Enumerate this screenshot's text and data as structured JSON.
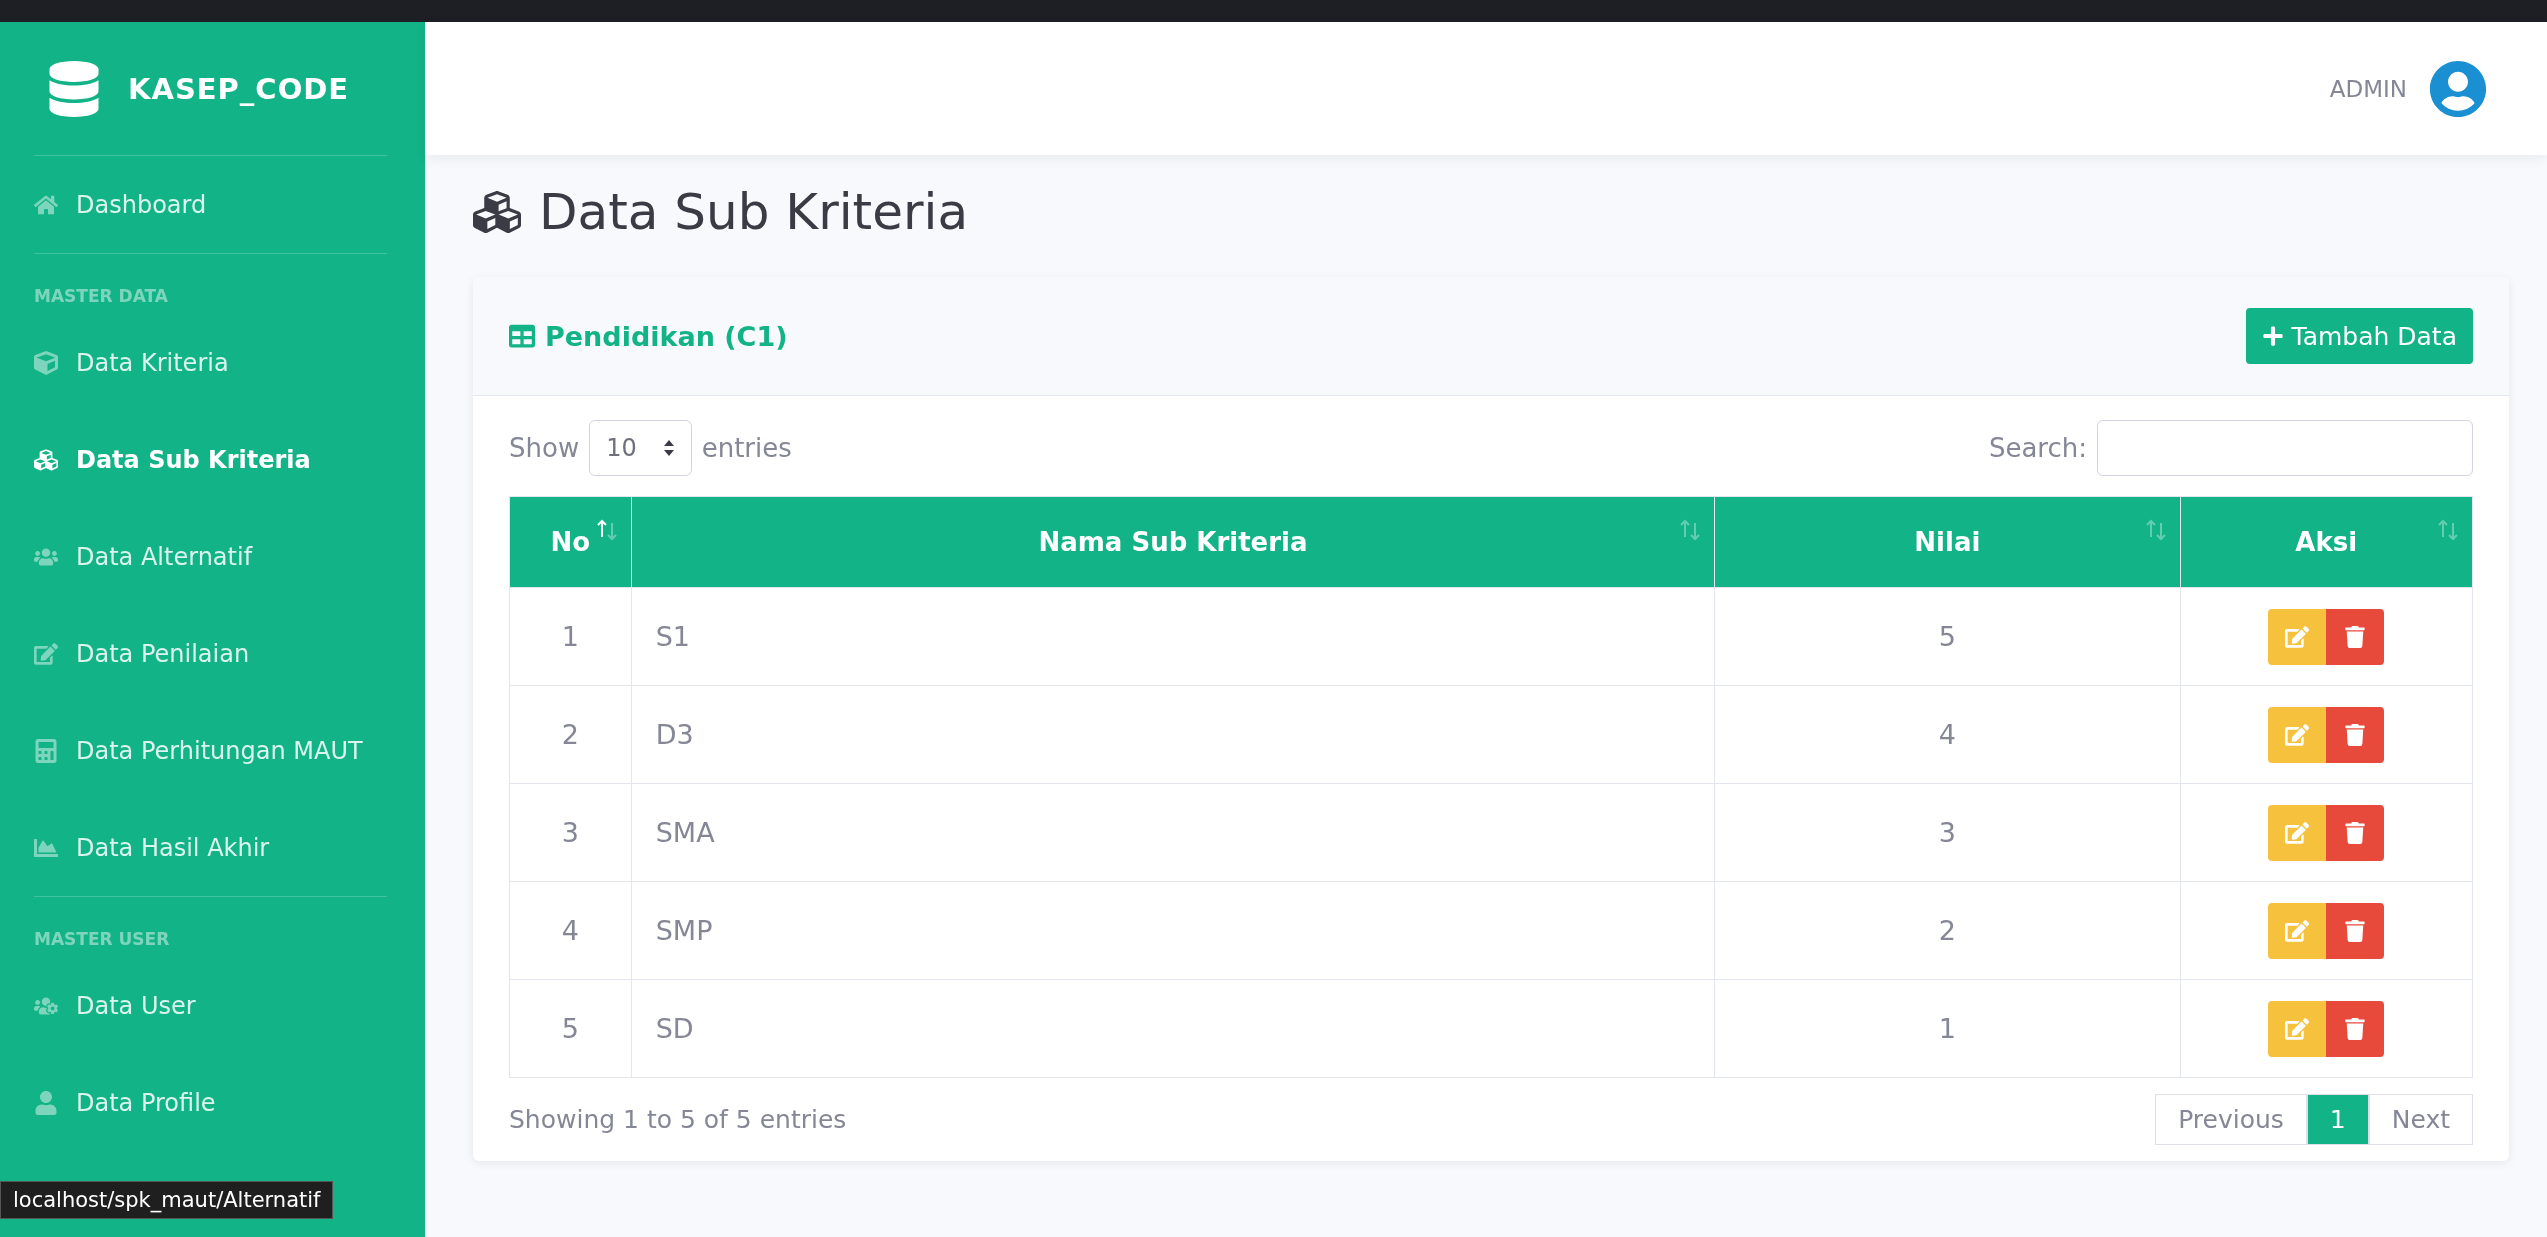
{
  "brand": "KASEP_CODE",
  "sidebar": {
    "sections": [
      {
        "items": [
          {
            "label": "Dashboard",
            "selected": false
          }
        ]
      },
      {
        "heading": "MASTER DATA",
        "items": [
          {
            "label": "Data Kriteria",
            "selected": false
          },
          {
            "label": "Data Sub Kriteria",
            "selected": true
          },
          {
            "label": "Data Alternatif",
            "selected": false
          },
          {
            "label": "Data Penilaian",
            "selected": false
          },
          {
            "label": "Data Perhitungan MAUT",
            "selected": false
          },
          {
            "label": "Data Hasil Akhir",
            "selected": false
          }
        ]
      },
      {
        "heading": "MASTER USER",
        "items": [
          {
            "label": "Data User",
            "selected": false
          },
          {
            "label": "Data Profile",
            "selected": false
          }
        ]
      }
    ]
  },
  "header": {
    "user": "ADMIN"
  },
  "page_title": "Data Sub Kriteria",
  "card": {
    "title": "Pendidikan (C1)",
    "add_button": "Tambah Data",
    "length": {
      "before": "Show",
      "value": "10",
      "after": "entries"
    },
    "search": {
      "label": "Search:"
    },
    "table": {
      "columns": [
        {
          "label": "No",
          "sorted": true
        },
        {
          "label": "Nama Sub Kriteria",
          "sorted": false
        },
        {
          "label": "Nilai",
          "sorted": false
        },
        {
          "label": "Aksi",
          "sorted": false
        }
      ],
      "rows": [
        {
          "no": "1",
          "name": "S1",
          "nilai": "5"
        },
        {
          "no": "2",
          "name": "D3",
          "nilai": "4"
        },
        {
          "no": "3",
          "name": "SMA",
          "nilai": "3"
        },
        {
          "no": "4",
          "name": "SMP",
          "nilai": "2"
        },
        {
          "no": "5",
          "name": "SD",
          "nilai": "1"
        }
      ]
    },
    "info": "Showing 1 to 5 of 5 entries",
    "pagination": [
      {
        "label": "Previous",
        "selected": false
      },
      {
        "label": "1",
        "selected": true
      },
      {
        "label": "Next",
        "selected": false
      }
    ]
  },
  "status_bar": "localhost/spk_maut/Alternatif"
}
